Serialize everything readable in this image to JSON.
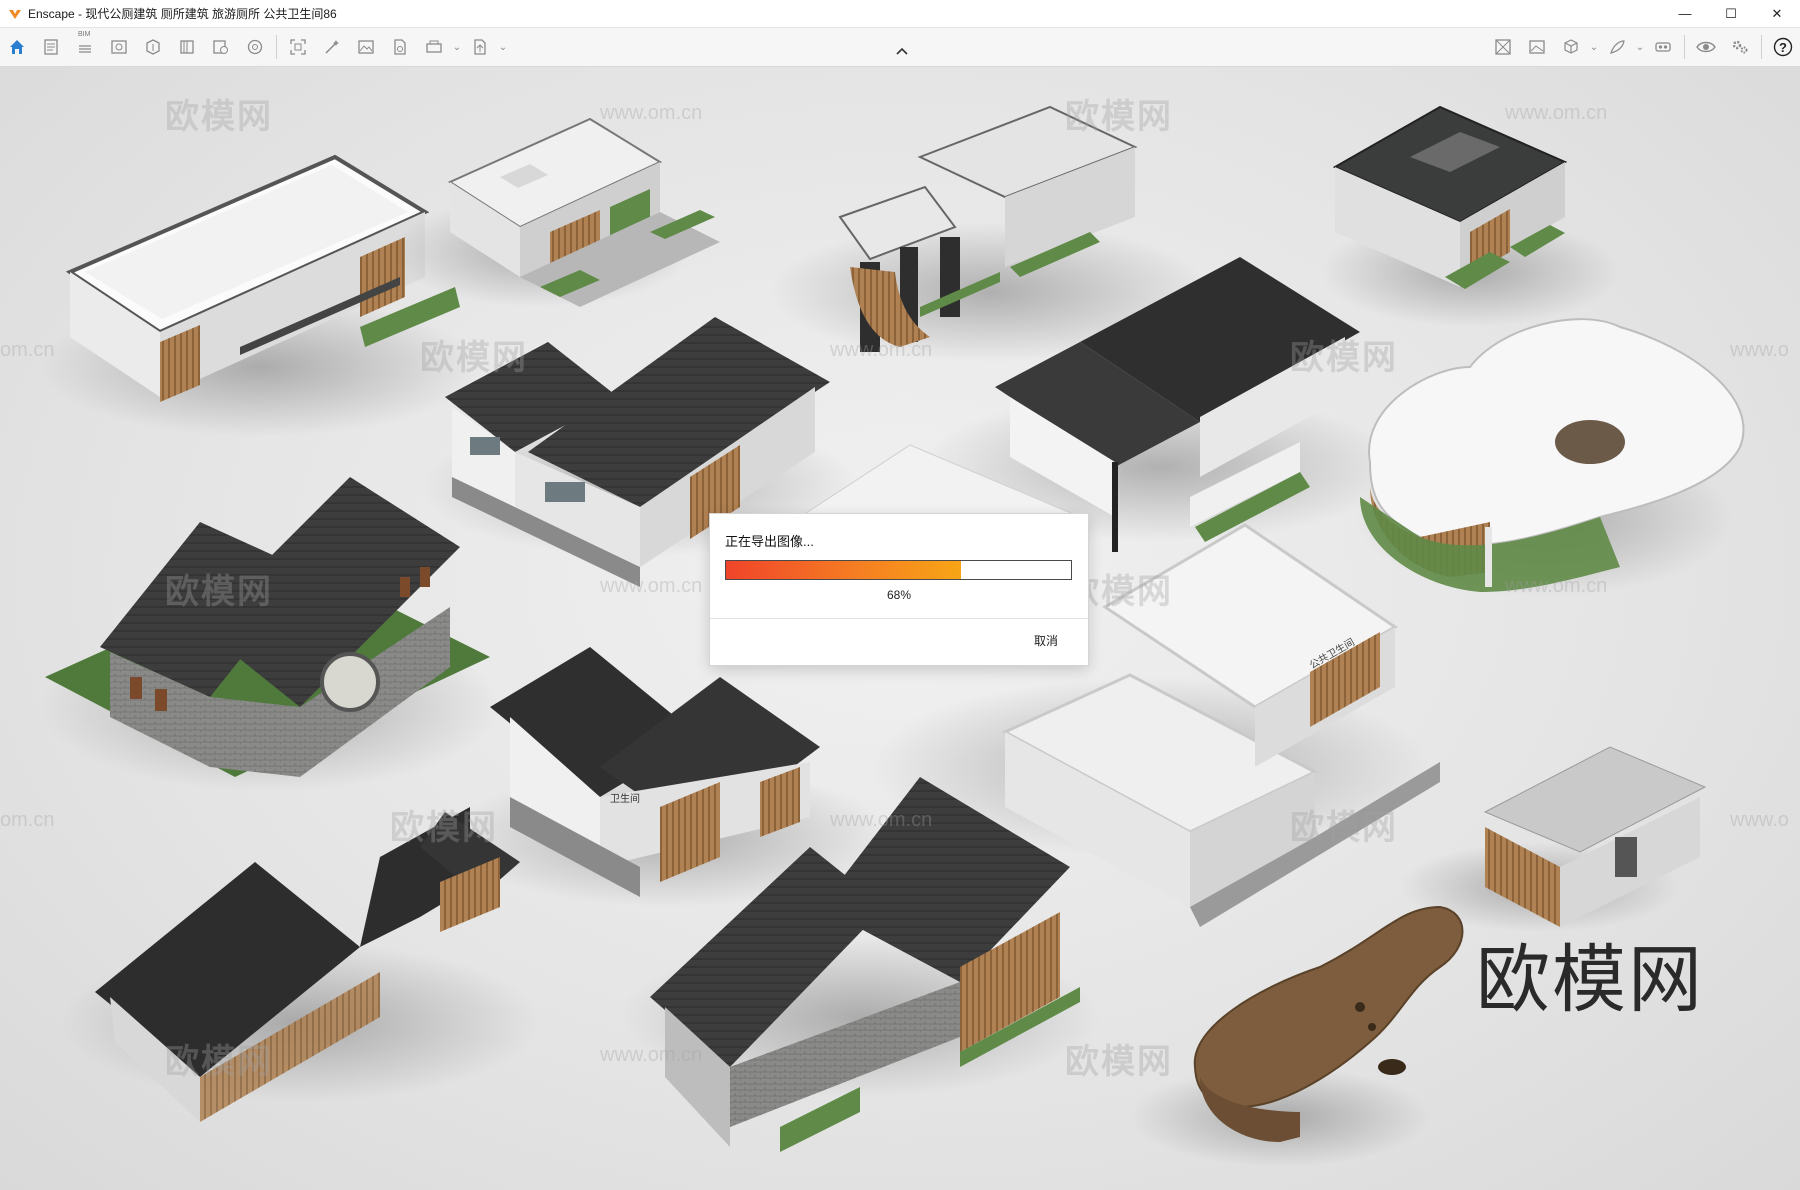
{
  "window": {
    "app_name": "Enscape",
    "separator": " - ",
    "document_title": "现代公厕建筑 厕所建筑 旅游厕所 公共卫生间86",
    "minimize_glyph": "—",
    "maximize_glyph": "☐",
    "close_glyph": "✕"
  },
  "toolbar": {
    "bim_label": "BIM",
    "left_icons": [
      "home-icon",
      "notes-icon",
      "bim-icon",
      "view-icon",
      "asset-library-icon",
      "visual-settings-icon",
      "material-editor-icon",
      "sun-icon",
      "screenshot-icon",
      "batch-render-icon",
      "panorama-icon",
      "video-editor-icon",
      "export-icon"
    ],
    "right_icons": [
      "site-context-icon",
      "render-image-icon",
      "cube-icon",
      "feather-icon",
      "vr-headset-icon",
      "eye-icon",
      "settings-icon",
      "help-icon"
    ],
    "help_glyph": "?"
  },
  "viewport": {
    "watermark_text": "欧模网",
    "watermark_url": "www.om.cn",
    "watermark_url_fragment": "om.cn",
    "watermark_url_fragment_right": "www.o",
    "building_sign_1": "公共卫生间",
    "building_sign_2": "卫生间"
  },
  "export_dialog": {
    "title": "正在导出图像...",
    "progress_percent": 68,
    "progress_label": "68%",
    "cancel_label": "取消"
  },
  "colors": {
    "accent": "#2a7fd0",
    "progress_start": "#f0442a",
    "progress_end": "#f7a516",
    "roof_dark": "#3a3a3a",
    "wood": "#a4774a",
    "grass": "#4f7a3c"
  }
}
